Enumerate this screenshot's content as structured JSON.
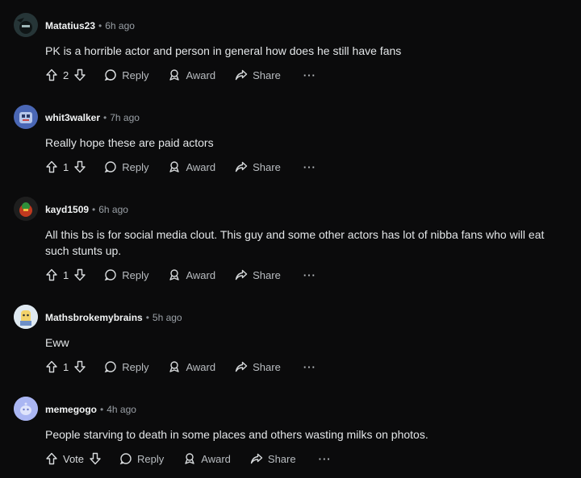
{
  "comments": [
    {
      "username": "Matatius23",
      "age": "6h ago",
      "text": "PK is a horrible actor and person in general how does he still have fans",
      "votes": "2",
      "reply": "Reply",
      "award": "Award",
      "share": "Share",
      "more": "···"
    },
    {
      "username": "whit3walker",
      "age": "7h ago",
      "text": "Really hope these are paid actors",
      "votes": "1",
      "reply": "Reply",
      "award": "Award",
      "share": "Share",
      "more": "···"
    },
    {
      "username": "kayd1509",
      "age": "6h ago",
      "text": "All this bs is for social media clout. This guy and some other actors has lot of nibba fans who will eat such stunts up.",
      "votes": "1",
      "reply": "Reply",
      "award": "Award",
      "share": "Share",
      "more": "···"
    },
    {
      "username": "Mathsbrokemybrains",
      "age": "5h ago",
      "text": "Eww",
      "votes": "1",
      "reply": "Reply",
      "award": "Award",
      "share": "Share",
      "more": "···"
    },
    {
      "username": "memegogo",
      "age": "4h ago",
      "text": "People starving to death in some places and others wasting milks on photos.",
      "votes": "Vote",
      "reply": "Reply",
      "award": "Award",
      "share": "Share",
      "more": "···"
    }
  ],
  "colors": {
    "background": "#0b0b0c",
    "text": "#e3e6e8",
    "muted": "#9aa0a6"
  },
  "icons": [
    "upvote-icon",
    "downvote-icon",
    "reply-icon",
    "award-icon",
    "share-icon",
    "more-icon"
  ]
}
